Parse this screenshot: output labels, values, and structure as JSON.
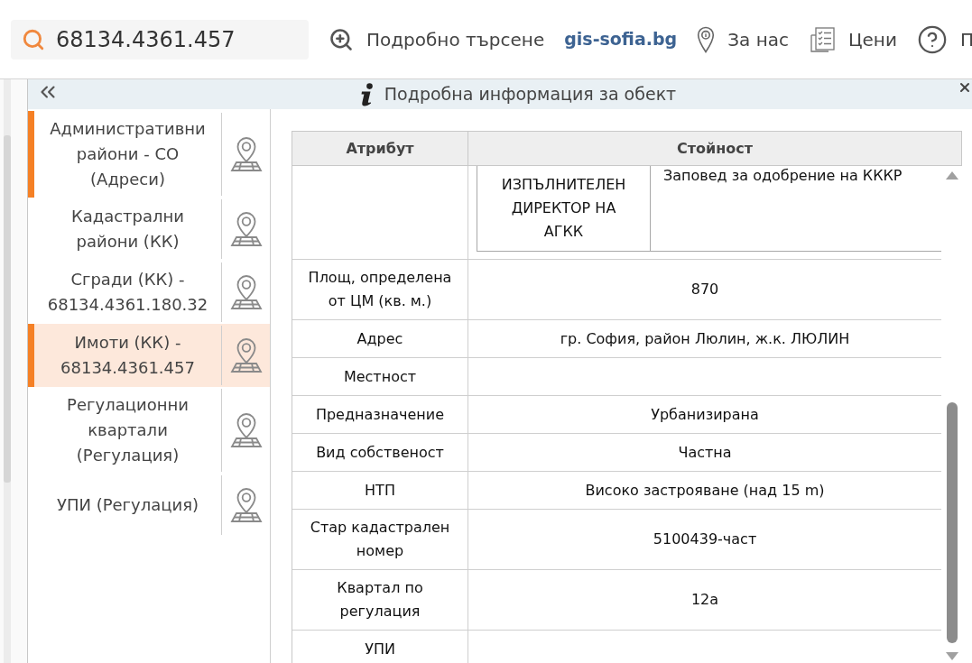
{
  "search": {
    "value": "68134.4361.457"
  },
  "toolbar": [
    {
      "kind": "link",
      "label": "Подробно търсене"
    },
    {
      "kind": "brand",
      "label": "gis-sofia.bg"
    },
    {
      "kind": "link",
      "label": "За нас"
    },
    {
      "kind": "link",
      "label": "Цени"
    },
    {
      "kind": "link",
      "label": "П"
    }
  ],
  "panel": {
    "title": "Подробна информация за обект"
  },
  "layers": [
    {
      "label": "Административни райони - СО (Адреси)",
      "marked": true,
      "selected": false
    },
    {
      "label": "Кадастрални райони (КК)",
      "marked": false,
      "selected": false
    },
    {
      "label": "Сгради (КК) - 68134.4361.180.32",
      "marked": false,
      "selected": false
    },
    {
      "label": "Имоти (КК) - 68134.4361.457",
      "marked": true,
      "selected": true
    },
    {
      "label": "Регулационни квартали (Регулация)",
      "marked": false,
      "selected": false
    },
    {
      "label": "УПИ (Регулация)",
      "marked": false,
      "selected": false
    }
  ],
  "table": {
    "columns": [
      "Атрибут",
      "Стойност"
    ],
    "rows": [
      {
        "kind": "nested",
        "cells": [
          "ИЗПЪЛНИТЕЛЕН ДИРЕКТОР НА АГКК",
          "Заповед за одобрение на КККР"
        ]
      },
      {
        "kind": "plain",
        "attribute": "Площ, определена от ЦМ (кв. м.)",
        "value": "870"
      },
      {
        "kind": "plain",
        "attribute": "Адрес",
        "value": "гр. София, район Люлин, ж.к. ЛЮЛИН"
      },
      {
        "kind": "plain",
        "attribute": "Местност"
      },
      {
        "kind": "plain",
        "attribute": "Предназначение",
        "value": "Урбанизирана"
      },
      {
        "kind": "plain",
        "attribute": "Вид собственост",
        "value": "Частна"
      },
      {
        "kind": "plain",
        "attribute": "НТП",
        "value": "Високо застрояване (над 15 m)"
      },
      {
        "kind": "plain",
        "attribute": "Стар кадастрален номер",
        "value": "5100439-част"
      },
      {
        "kind": "plain",
        "attribute": "Квартал по регулация",
        "value": "12а"
      },
      {
        "kind": "plain",
        "attribute": "УПИ"
      }
    ]
  }
}
